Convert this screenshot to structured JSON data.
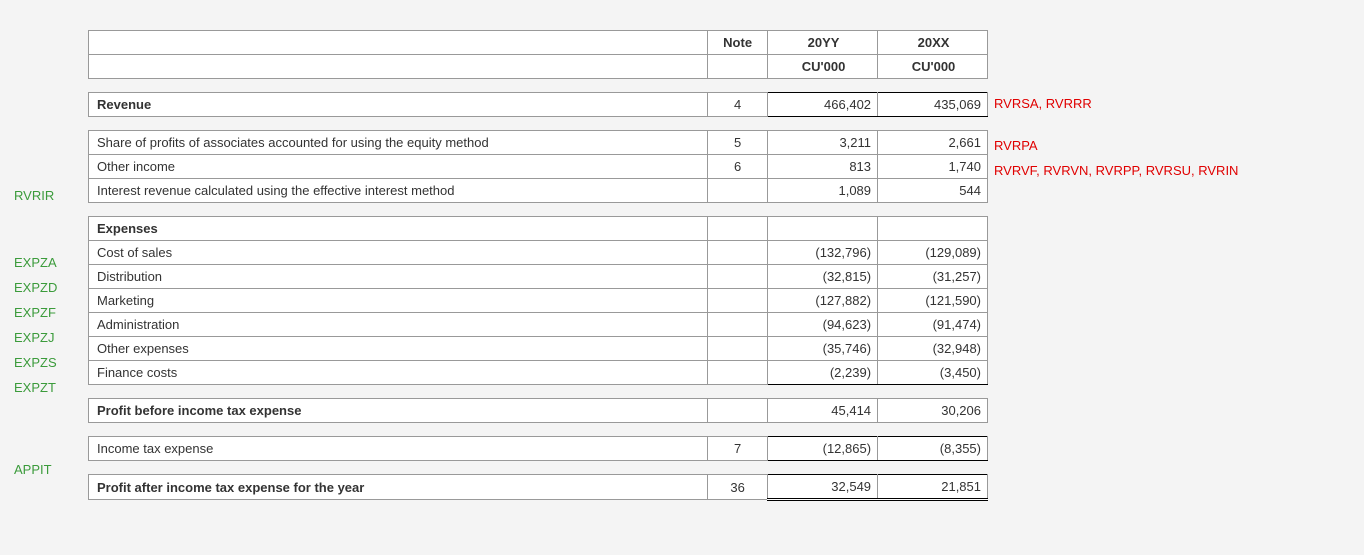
{
  "headers": {
    "note": "Note",
    "yy": "20YY",
    "xx": "20XX",
    "unit": "CU'000"
  },
  "rows": {
    "revenue": {
      "label": "Revenue",
      "note": "4",
      "yy": "466,402",
      "xx": "435,069"
    },
    "share": {
      "label": "Share of profits of associates accounted for using the equity method",
      "note": "5",
      "yy": "3,211",
      "xx": "2,661"
    },
    "other_income": {
      "label": "Other income",
      "note": "6",
      "yy": "813",
      "xx": "1,740"
    },
    "interest_rev": {
      "label": "Interest revenue calculated using the effective interest method",
      "note": "",
      "yy": "1,089",
      "xx": "544"
    },
    "expenses_hdr": {
      "label": "Expenses"
    },
    "cost_sales": {
      "label": "Cost of sales",
      "note": "",
      "yy": "(132,796)",
      "xx": "(129,089)"
    },
    "distribution": {
      "label": "Distribution",
      "note": "",
      "yy": "(32,815)",
      "xx": "(31,257)"
    },
    "marketing": {
      "label": "Marketing",
      "note": "",
      "yy": "(127,882)",
      "xx": "(121,590)"
    },
    "admin": {
      "label": "Administration",
      "note": "",
      "yy": "(94,623)",
      "xx": "(91,474)"
    },
    "other_exp": {
      "label": "Other expenses",
      "note": "",
      "yy": "(35,746)",
      "xx": "(32,948)"
    },
    "finance": {
      "label": "Finance costs",
      "note": "",
      "yy": "(2,239)",
      "xx": "(3,450)"
    },
    "pbt": {
      "label": "Profit before income tax expense",
      "note": "",
      "yy": "45,414",
      "xx": "30,206"
    },
    "tax": {
      "label": "Income tax expense",
      "note": "7",
      "yy": "(12,865)",
      "xx": "(8,355)"
    },
    "pat": {
      "label": "Profit after income tax expense for the year",
      "note": "36",
      "yy": "32,549",
      "xx": "21,851"
    }
  },
  "left_tags": {
    "interest_rev": "RVRIR",
    "cost_sales": "EXPZA",
    "distribution": "EXPZD",
    "marketing": "EXPZF",
    "admin": "EXPZJ",
    "other_exp": "EXPZS",
    "finance": "EXPZT",
    "tax": "APPIT"
  },
  "right_tags": {
    "revenue": "RVRSA, RVRRR",
    "share": "RVRPA",
    "other_income": "RVRVF, RVRVN, RVRPP, RVRSU, RVRIN"
  }
}
